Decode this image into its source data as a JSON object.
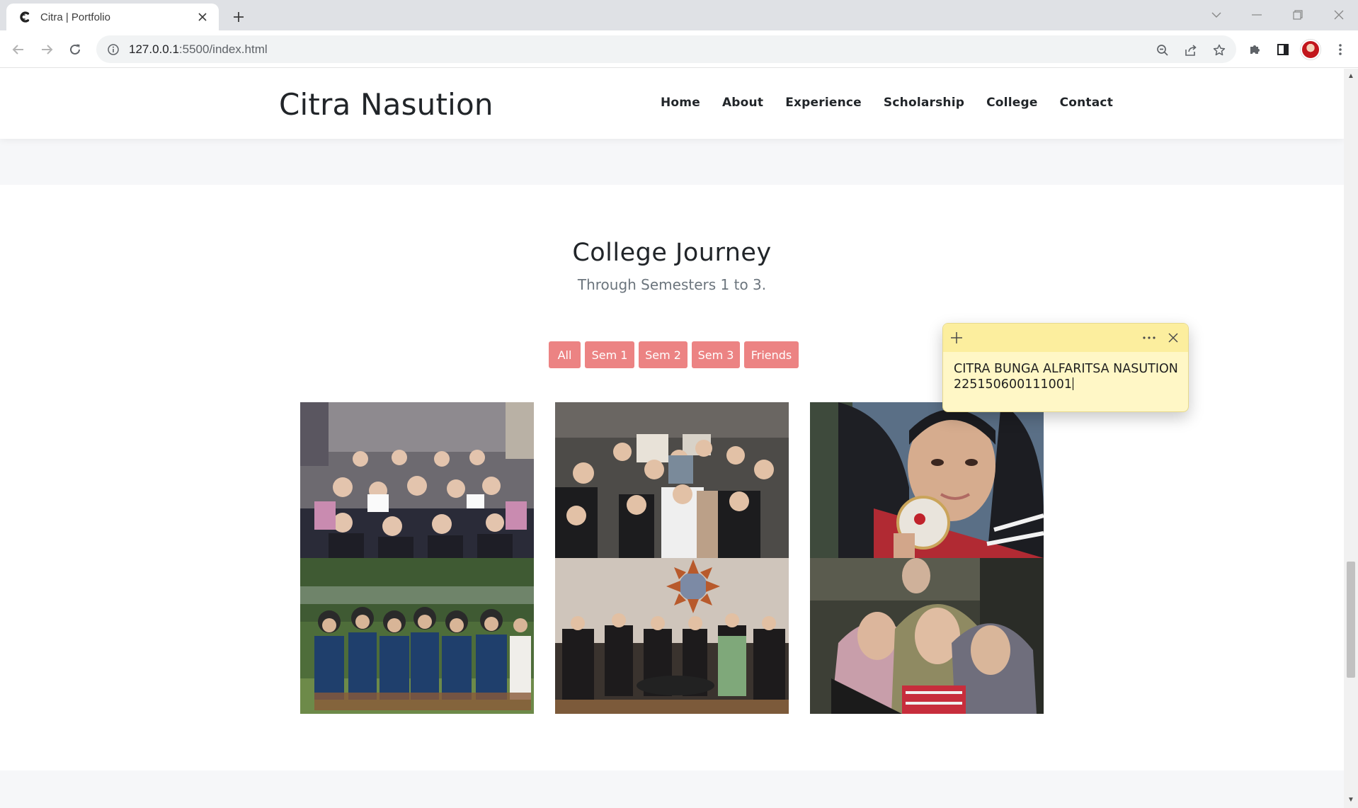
{
  "browser": {
    "tab_title": "Citra | Portfolio",
    "url_host": "127.0.0.1",
    "url_rest": ":5500/index.html"
  },
  "site": {
    "brand": "Citra Nasution",
    "nav": [
      "Home",
      "About",
      "Experience",
      "Scholarship",
      "College",
      "Contact"
    ]
  },
  "section": {
    "title": "College Journey",
    "subtitle": "Through Semesters 1 to 3.",
    "filters": [
      "All",
      "Sem 1",
      "Sem 2",
      "Sem 3",
      "Friends"
    ],
    "filter_color": "#ec8383"
  },
  "sticky_note": {
    "line1": "CITRA BUNGA ALFARITSA NASUTION",
    "line2": "225150600111001"
  },
  "colors": {
    "accent": "#ec8383",
    "sticky_bg": "#fff7c6",
    "sticky_bar": "#fcee9e",
    "band": "#f6f7f9"
  },
  "icons": {
    "tab_favicon": "c-logo-icon",
    "tab_close": "close-icon",
    "new_tab": "plus-icon",
    "back": "arrow-left-icon",
    "forward": "arrow-right-icon",
    "reload": "reload-icon",
    "site_info": "info-icon",
    "zoom": "zoom-out-icon",
    "share": "share-icon",
    "bookmark": "star-icon",
    "extensions": "puzzle-icon",
    "side_panel": "side-panel-icon",
    "menu": "kebab-menu-icon"
  }
}
